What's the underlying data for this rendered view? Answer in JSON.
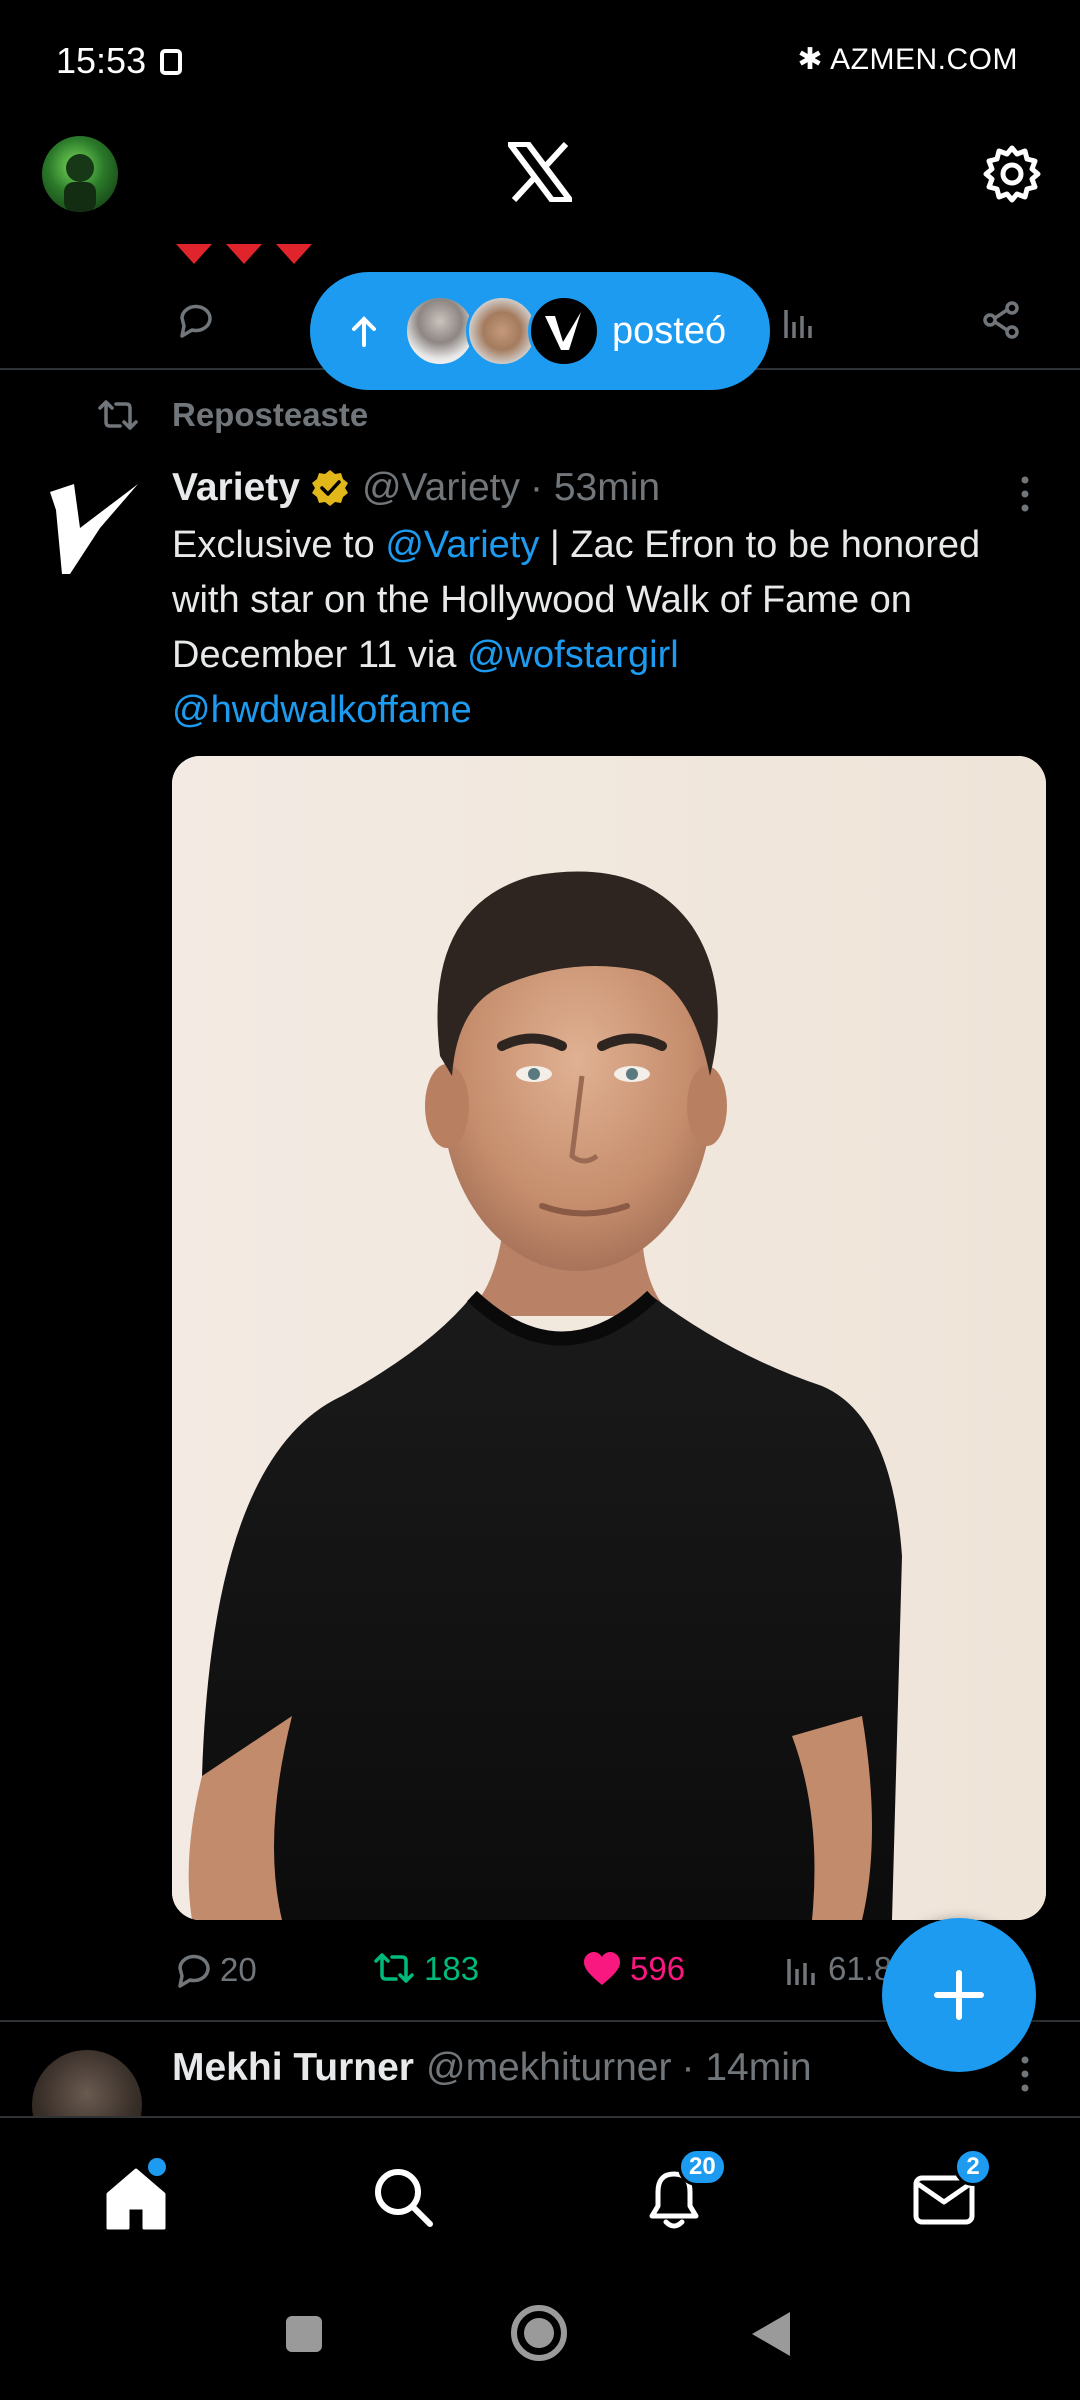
{
  "status_bar": {
    "time": "15:53",
    "right_text": "AZMEN.COM"
  },
  "header": {
    "logo": "x-logo",
    "settings_icon": "gear-icon"
  },
  "new_posts_pill": {
    "label": "posteó"
  },
  "repost": {
    "label": "Reposteaste"
  },
  "tweet": {
    "author_name": "Variety",
    "author_handle": "@Variety",
    "time": "· 53min",
    "text_parts": {
      "p1": "Exclusive to ",
      "m1": "@Variety",
      "p2": " | Zac Efron to be honored with star on the Hollywood Walk of Fame on December 11 via ",
      "m2": "@wofstargirl",
      "m3": "@hwdwalkoffame"
    },
    "actions": {
      "replies": "20",
      "reposts": "183",
      "likes": "596",
      "views": "61.8"
    }
  },
  "next_tweet": {
    "author_name": "Mekhi Turner",
    "author_handle": "@mekhiturner",
    "time": "· 14min"
  },
  "bottom_nav": {
    "notifications_badge": "20",
    "messages_badge": "2"
  },
  "colors": {
    "accent": "#1d9bf0",
    "repost_green": "#00ba7c",
    "like_pink": "#f91880",
    "verified_gold": "#e2b719",
    "muted": "#71767b"
  }
}
